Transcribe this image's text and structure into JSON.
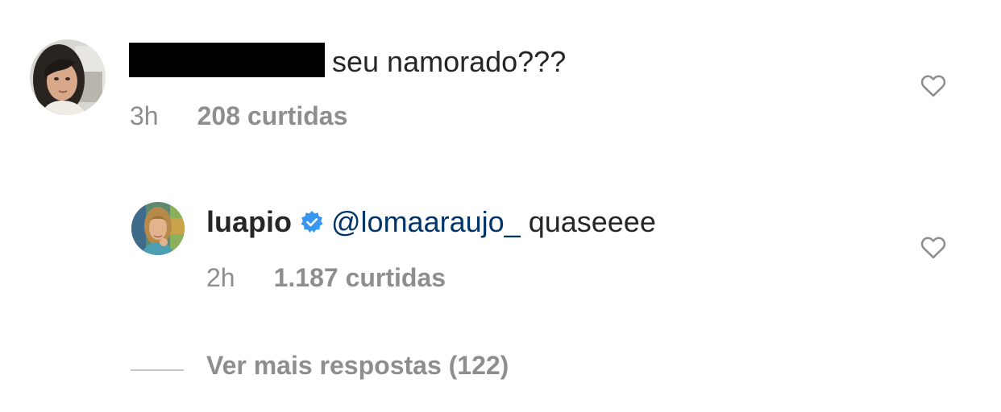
{
  "comment": {
    "text": "seu namorado???",
    "time": "3h",
    "likes": "208 curtidas",
    "username_redacted": true
  },
  "reply": {
    "username": "luapio",
    "verified": true,
    "mention": "@lomaaraujo_",
    "text": "quaseeee",
    "time": "2h",
    "likes": "1.187 curtidas"
  },
  "more_replies": {
    "label": "Ver mais respostas (122)"
  },
  "icons": {
    "like": "heart-outline-icon",
    "verified": "verified-badge-icon"
  },
  "colors": {
    "text_primary": "#262626",
    "text_secondary": "#8e8e8e",
    "mention": "#003569",
    "verified_blue": "#3897f0"
  }
}
